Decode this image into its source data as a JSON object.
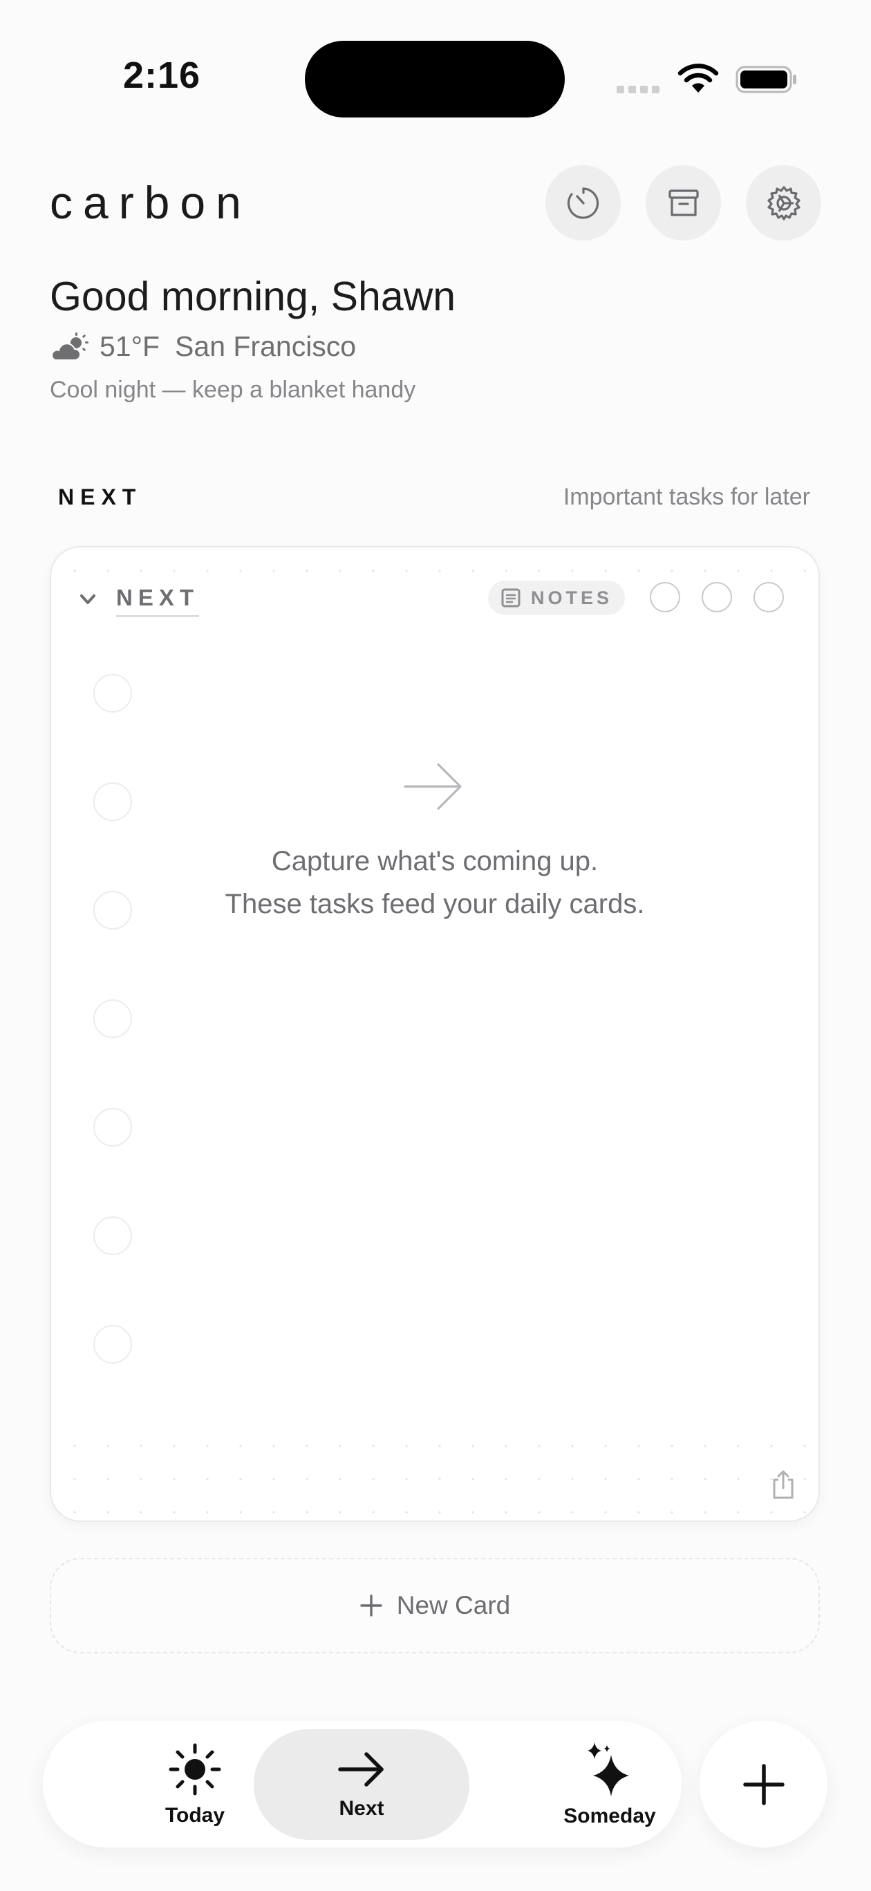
{
  "status_bar": {
    "time": "2:16"
  },
  "header": {
    "logo": "carbon",
    "buttons": [
      {
        "name": "timer-icon"
      },
      {
        "name": "archive-icon"
      },
      {
        "name": "gear-icon"
      }
    ]
  },
  "greeting": {
    "text": "Good morning, Shawn",
    "temperature": "51°F",
    "city": "San Francisco",
    "note": "Cool night — keep a blanket handy"
  },
  "section": {
    "title": "NEXT",
    "subtitle": "Important tasks for later"
  },
  "card": {
    "title": "NEXT",
    "notes_label": "NOTES",
    "empty_line1": "Capture what's coming up.",
    "empty_line2": "These tasks feed your daily cards."
  },
  "new_card": {
    "label": "New Card"
  },
  "tabs": [
    {
      "label": "Today",
      "icon": "sun-icon"
    },
    {
      "label": "Next",
      "icon": "arrow-right-icon",
      "selected": true
    },
    {
      "label": "Someday",
      "icon": "sparkles-icon"
    }
  ],
  "colors": {
    "accent": "#111111",
    "muted": "#6d6d72",
    "tab_selected_bg": "#ebebec"
  }
}
